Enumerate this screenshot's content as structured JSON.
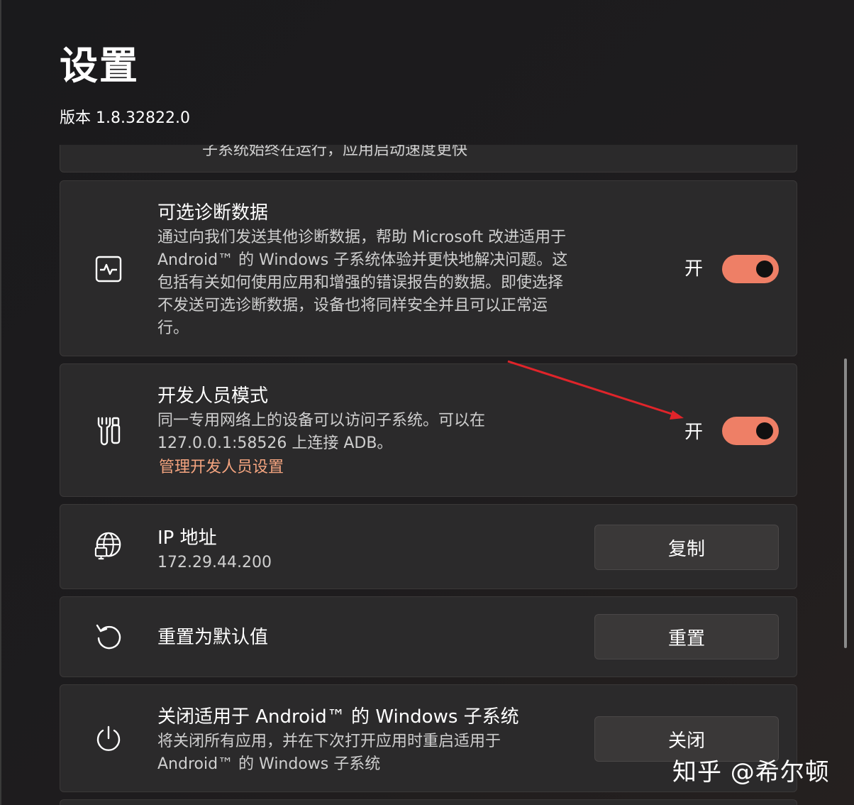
{
  "header": {
    "title": "设置",
    "version": "版本 1.8.32822.0"
  },
  "settings": {
    "clipped_text": "子系统始终在运行，应用启动速度更快",
    "diagnostics": {
      "title": "可选诊断数据",
      "description": "通过向我们发送其他诊断数据，帮助 Microsoft 改进适用于 Android™ 的 Windows 子系统体验并更快地解决问题。这包括有关如何使用应用和增强的错误报告的数据。即使选择不发送可选诊断数据，设备也将同样安全并且可以正常运行。",
      "toggle_label": "开",
      "toggle_on": true,
      "icon": "pulse-icon"
    },
    "developer_mode": {
      "title": "开发人员模式",
      "description_line1": "同一专用网络上的设备可以访问子系统。可以在",
      "description_line2": "127.0.0.1:58526 上连接 ADB。",
      "link": "管理开发人员设置",
      "toggle_label": "开",
      "toggle_on": true,
      "icon": "wrench-screwdriver-icon"
    },
    "ip_address": {
      "title": "IP 地址",
      "value": "172.29.44.200",
      "button": "复制",
      "icon": "globe-network-icon"
    },
    "reset": {
      "title": "重置为默认值",
      "button": "重置",
      "icon": "reset-icon"
    },
    "shutdown": {
      "title": "关闭适用于 Android™ 的 Windows 子系统",
      "description_line1": "将关闭所有应用，并在下次打开应用时重启适用于",
      "description_line2": "Android™ 的 Windows 子系统",
      "button": "关闭",
      "icon": "power-icon"
    }
  },
  "watermark": "知乎 @希尔顿",
  "colors": {
    "accent": "#ee7f66",
    "link": "#f4a47f",
    "card": "#2b2a2b",
    "annotation_arrow": "#e0242a"
  }
}
